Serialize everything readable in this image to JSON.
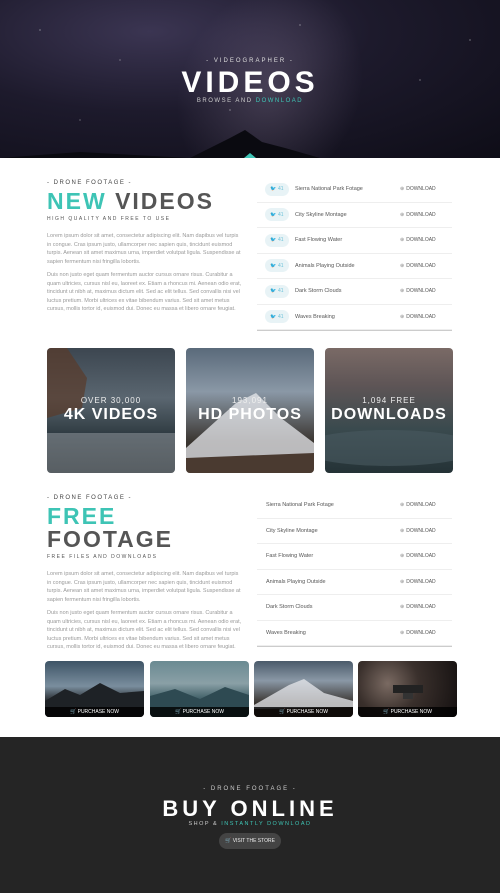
{
  "hero": {
    "kicker": "- VIDEOGRAPHER -",
    "title": "VIDEOS",
    "sub_a": "BROWSE AND ",
    "sub_b": "DOWNLOAD"
  },
  "new_section": {
    "kicker": "- DRONE FOOTAGE -",
    "heading_a": "NEW",
    "heading_b": "VIDEOS",
    "sub": "HIGH QUALITY AND FREE TO USE",
    "para1": "Lorem ipsum dolor sit amet, consectetur adipiscing elit. Nam dapibus vel turpis in congue. Cras ipsum justo, ullamcorper nec sapien quis, tincidunt euismod turpis. Aenean sit amet maximus urna, imperdiet volutpat ligula. Suspendisse at sapien fermentum nisi fringilla lobortis.",
    "para2": "Duis non justo eget quam fermentum auctor cursus ornare risus. Curabitur a quam ultricies, cursus nisl eu, laoreet ex. Etiam a rhoncus mi. Aenean odio erat, tincidunt ut nibh at, maximus dictum elit. Sed ac elit tellus. Sed convallis nisi vel luctus pretium. Morbi ultrices ex vitae bibendum varius. Sed sit amet metus cursus, mollis tortor id, euismod dui. Donec eu massa et libero ornare feugiat.",
    "list": [
      {
        "count": "41",
        "name": "Sierra National Park Fotage",
        "dl": "DOWNLOAD"
      },
      {
        "count": "41",
        "name": "City Skyline Montage",
        "dl": "DOWNLOAD"
      },
      {
        "count": "41",
        "name": "Fast Flowing Water",
        "dl": "DOWNLOAD"
      },
      {
        "count": "41",
        "name": "Animals Playing Outside",
        "dl": "DOWNLOAD"
      },
      {
        "count": "41",
        "name": "Dark Storm Clouds",
        "dl": "DOWNLOAD"
      },
      {
        "count": "41",
        "name": "Waves Breaking",
        "dl": "DOWNLOAD"
      }
    ]
  },
  "cards": [
    {
      "small": "OVER 30,000",
      "large": "4K VIDEOS"
    },
    {
      "small": "193,091",
      "large": "HD PHOTOS"
    },
    {
      "small": "1,094 FREE",
      "large": "DOWNLOADS"
    }
  ],
  "free_section": {
    "kicker": "- DRONE FOOTAGE -",
    "heading_a": "FREE",
    "heading_b": "FOOTAGE",
    "sub": "FREE FILES AND DOWNLOADS",
    "para1": "Lorem ipsum dolor sit amet, consectetur adipiscing elit. Nam dapibus vel turpis in congue. Cras ipsum justo, ullamcorper nec sapien quis, tincidunt euismod turpis. Aenean sit amet maximus urna, imperdiet volutpat ligula. Suspendisse at sapien fermentum nisi fringilla lobortis.",
    "para2": "Duis non justo eget quam fermentum auctor cursus ornare risus. Curabitur a quam ultricies, cursus nisl eu, laoreet ex. Etiam a rhoncus mi. Aenean odio erat, tincidunt ut nibh at, maximus dictum elit. Sed ac elit tellus. Sed convallis nisi vel luctus pretium. Morbi ultrices ex vitae bibendum varius. Sed sit amet metus cursus, mollis tortor id, euismod dui. Donec eu massa et libero ornare feugiat.",
    "list": [
      {
        "name": "Sierra National Park Fotage",
        "dl": "DOWNLOAD"
      },
      {
        "name": "City Skyline Montage",
        "dl": "DOWNLOAD"
      },
      {
        "name": "Fast Flowing Water",
        "dl": "DOWNLOAD"
      },
      {
        "name": "Animals Playing Outside",
        "dl": "DOWNLOAD"
      },
      {
        "name": "Dark Storm Clouds",
        "dl": "DOWNLOAD"
      },
      {
        "name": "Waves Breaking",
        "dl": "DOWNLOAD"
      }
    ]
  },
  "thumbs": [
    {
      "label": "PURCHASE NOW"
    },
    {
      "label": "PURCHASE NOW"
    },
    {
      "label": "PURCHASE NOW"
    },
    {
      "label": "PURCHASE NOW"
    }
  ],
  "footer": {
    "kicker": "- DRONE FOOTAGE -",
    "title": "BUY ONLINE",
    "sub_a": "SHOP & ",
    "sub_b": "INSTANTLY DOWNLOAD",
    "button": "VISIT THE STORE"
  },
  "colors": {
    "accent": "#3ec4b5",
    "footer_bg": "#252525"
  },
  "icons": {
    "twitter": "twitter-icon",
    "download": "download-icon",
    "cart": "cart-icon"
  }
}
